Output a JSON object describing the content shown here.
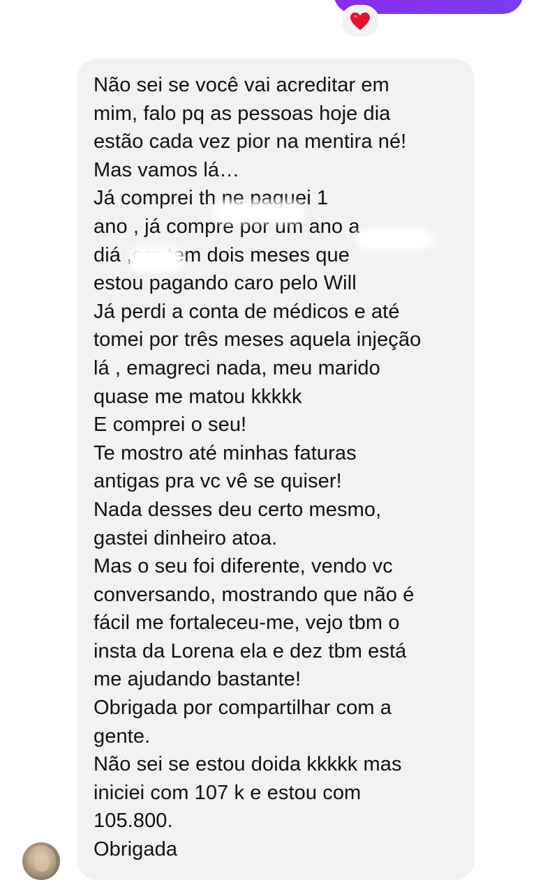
{
  "thread": {
    "reaction_emoji": "❤️",
    "reaction_icon": "heart-icon",
    "received_message": {
      "lines": [
        "Não sei se você vai acreditar em",
        "mim, falo pq as pessoas hoje dia",
        "estão cada vez pior na mentira né!",
        "Mas vamos lá…",
        "Já comprei th          ne paguei 1",
        "ano , já compre por um ano           a",
        "diá          ,ora tem dois meses que",
        "estou pagando caro pelo Will",
        "Já perdi a conta de médicos e até",
        "tomei por três meses aquela injeção",
        "lá , emagreci nada, meu marido",
        "quase me matou kkkkk",
        "E comprei o seu!",
        "Te mostro até minhas faturas",
        "antigas pra vc vê se quiser!",
        "Nada desses deu certo mesmo,",
        "gastei dinheiro atoa.",
        "Mas o seu foi diferente, vendo vc",
        "conversando, mostrando que não é",
        "fácil me fortaleceu-me, vejo tbm o",
        "insta da Lorena ela e dez tbm está",
        "me ajudando bastante!",
        "Obrigada por compartilhar com a",
        "gente.",
        "Não sei se estou doida kkkkk mas",
        "iniciei com 107 k e estou com",
        "105.800.",
        "Obrigada"
      ]
    }
  },
  "colors": {
    "sent_bubble": "#8a2cf0",
    "received_bubble": "#f2f2f4",
    "text": "#111111",
    "reaction_bg": "#f2f2f3",
    "heart": "#e5112e"
  }
}
